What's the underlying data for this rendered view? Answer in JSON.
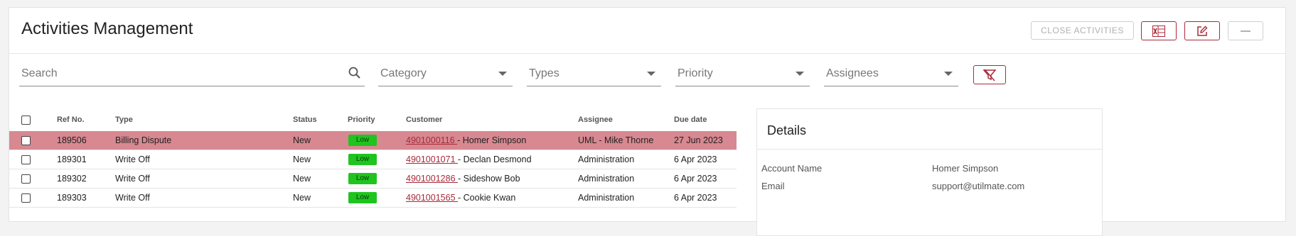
{
  "header": {
    "title": "Activities Management",
    "close_label": "CLOSE ACTIVITIES"
  },
  "filters": {
    "search": "Search",
    "category": "Category",
    "types": "Types",
    "priority": "Priority",
    "assignees": "Assignees"
  },
  "table": {
    "columns": [
      "Ref No.",
      "Type",
      "Status",
      "Priority",
      "Customer",
      "Assignee",
      "Due date"
    ],
    "rows": [
      {
        "ref": "189506",
        "type": "Billing Dispute",
        "status": "New",
        "priority": "Low",
        "acct": "4901000116 ",
        "name": "- Homer Simpson",
        "assignee": "UML - Mike Thorne",
        "due": "27 Jun 2023"
      },
      {
        "ref": "189301",
        "type": "Write Off",
        "status": "New",
        "priority": "Low",
        "acct": "4901001071 ",
        "name": "- Declan Desmond",
        "assignee": "Administration",
        "due": "6 Apr 2023"
      },
      {
        "ref": "189302",
        "type": "Write Off",
        "status": "New",
        "priority": "Low",
        "acct": "4901001286 ",
        "name": "- Sideshow Bob",
        "assignee": "Administration",
        "due": "6 Apr 2023"
      },
      {
        "ref": "189303",
        "type": "Write Off",
        "status": "New",
        "priority": "Low",
        "acct": "4901001565 ",
        "name": "- Cookie Kwan",
        "assignee": "Administration",
        "due": "6 Apr 2023"
      }
    ]
  },
  "details": {
    "title": "Details",
    "fields": [
      {
        "label": "Account Name",
        "value": "Homer Simpson"
      },
      {
        "label": "Email",
        "value": "support@utilmate.com"
      }
    ]
  },
  "colors": {
    "accent": "#a82a3a",
    "selected_row": "#d78890",
    "low_badge": "#1fc41f"
  },
  "icons": [
    "excel-icon",
    "edit-icon",
    "minus-icon",
    "search-icon",
    "clear-filter-icon"
  ]
}
